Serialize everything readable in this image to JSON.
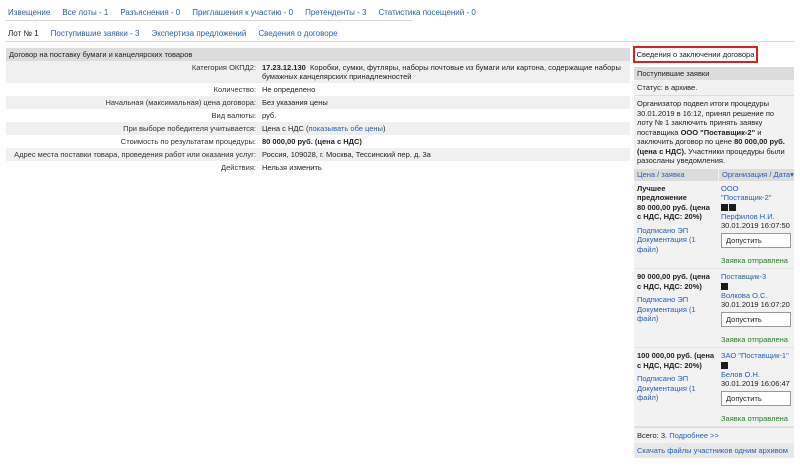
{
  "top_nav": [
    {
      "label": "Извещение"
    },
    {
      "label": "Все лоты - 1"
    },
    {
      "label": "Разъяснения - 0"
    },
    {
      "label": "Приглашения к участию - 0"
    },
    {
      "label": "Претенденты - 3"
    },
    {
      "label": "Статистика посещений - 0"
    }
  ],
  "sub_nav": [
    {
      "label": "Лот № 1"
    },
    {
      "label": "Поступившие заявки - 3"
    },
    {
      "label": "Экспертиза предложений"
    },
    {
      "label": "Сведения о договоре"
    }
  ],
  "lot": {
    "header": "Договор на поставку бумаги и канцелярских товаров",
    "rows": [
      {
        "label": "Категория ОКПД2:",
        "code": "17.23.12.130",
        "value": "Коробки, сумки, футляры, наборы почтовые из бумаги или картона, содержащие наборы бумажных канцелярских принадлежностей"
      },
      {
        "label": "Количество:",
        "value": "Не определено"
      },
      {
        "label": "Начальная (максимальная) цена договора:",
        "value": "Без указания цены"
      },
      {
        "label": "Вид валюты:",
        "value": "руб."
      },
      {
        "label": "При выборе победителя учитывается:",
        "value": "Цена с НДС",
        "link": "показывать обе цены"
      },
      {
        "label": "Стоимость по результатам процедуры:",
        "value": "80 000,00 руб. (цена с НДС)"
      },
      {
        "label": "Адрес места поставки товара, проведения работ или оказания услуг:",
        "value": "Россия, 109028, г. Москва, Тессинский пер. д. 3а"
      },
      {
        "label": "Действия:",
        "value": "Нельзя изменить"
      }
    ]
  },
  "right": {
    "contract_button": "Сведения о заключении договора",
    "header": "Поступившие заявки",
    "status": "Статус: в архиве.",
    "desc_1": "Организатор подвел итоги процедуры 30.01.2019 в 16:12, принял решение по лоту № 1 заключить принять заявку поставщика",
    "desc_supplier": "ООО \"Поставщик-2\"",
    "desc_2": "и заключить договор по цене",
    "desc_price": "80 000,00 руб. (цена с НДС).",
    "desc_3": "Участники процедуры были разосланы уведомления.",
    "col_price": "Цена / заявка",
    "col_org": "Организация / Дата▾",
    "bids": [
      {
        "best": "Лучшее предложение",
        "price": "80 000,00 руб. (цена с НДС, НДС: 20%)",
        "signed": "Подписано ЭП",
        "docs": "Документация (1 файл)",
        "org": "ООО \"Поставщик-2\"",
        "person": "Перфилов Н.И.",
        "date": "30.01.2019 16:07:50",
        "admit": "Допустить",
        "sent": "Заявка отправлена"
      },
      {
        "best": "",
        "price": "90 000,00 руб. (цена с НДС, НДС: 20%)",
        "signed": "Подписано ЭП",
        "docs": "Документация (1 файл)",
        "org": "Поставщик-3",
        "person": "Волкова О.С.",
        "date": "30.01.2019 16:07:20",
        "admit": "Допустить",
        "sent": "Заявка отправлена"
      },
      {
        "best": "",
        "price": "100 000,00 руб. (цена с НДС, НДС: 20%)",
        "signed": "Подписано ЭП",
        "docs": "Документация (1 файл)",
        "org": "ЗАО \"Поставщик-1\"",
        "person": "Белов О.Н.",
        "date": "30.01.2019 16:06:47",
        "admit": "Допустить",
        "sent": "Заявка отправлена"
      }
    ],
    "total": "Всего: 3.",
    "more": "Подробнее >>",
    "download": "Скачать файлы участников одним архивом"
  }
}
